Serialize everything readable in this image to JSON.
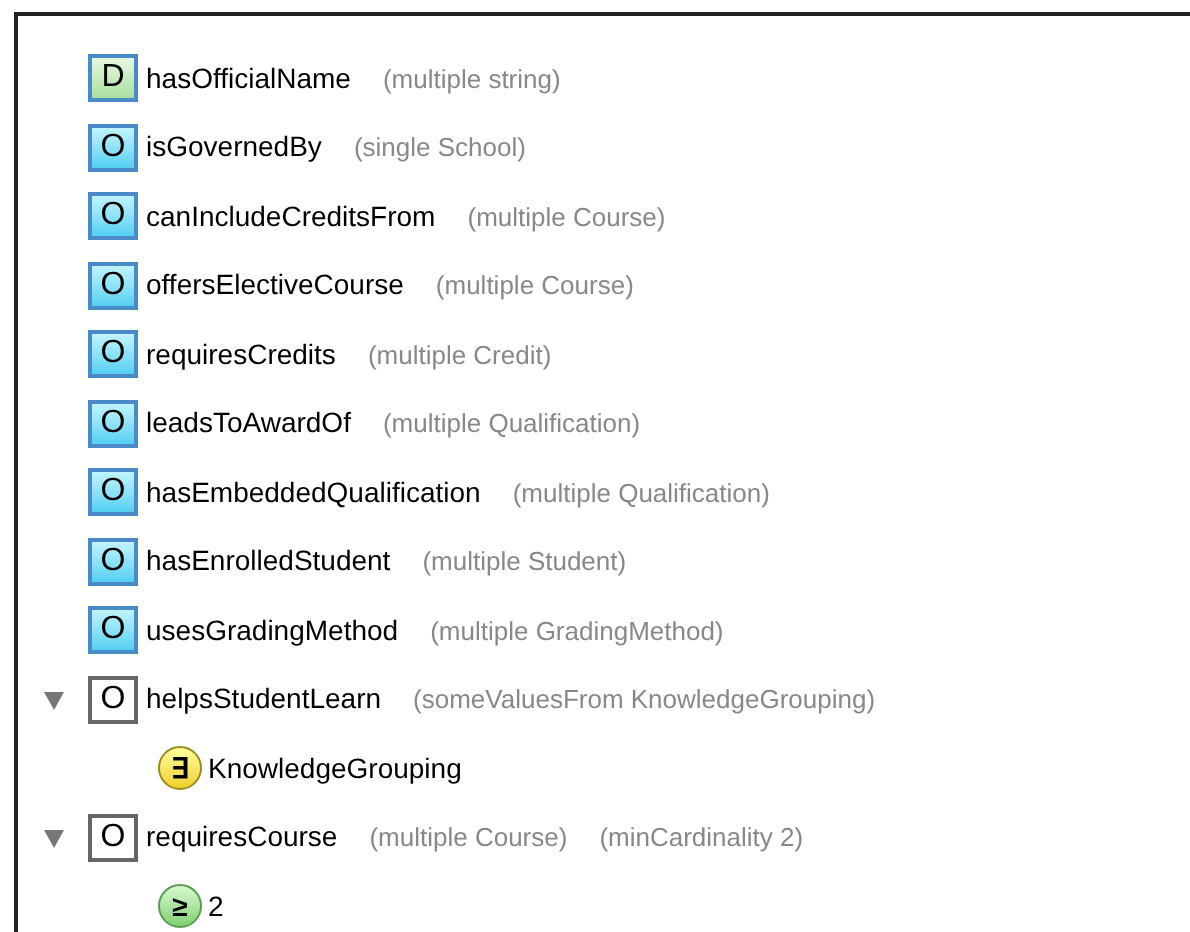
{
  "properties": [
    {
      "kind": "datatype",
      "icon": "D",
      "name": "hasOfficialName",
      "details": [
        "(multiple string)"
      ]
    },
    {
      "kind": "object",
      "icon": "O",
      "name": "isGovernedBy",
      "details": [
        "(single School)"
      ]
    },
    {
      "kind": "object",
      "icon": "O",
      "name": "canIncludeCreditsFrom",
      "details": [
        "(multiple Course)"
      ]
    },
    {
      "kind": "object",
      "icon": "O",
      "name": "offersElectiveCourse",
      "details": [
        "(multiple Course)"
      ]
    },
    {
      "kind": "object",
      "icon": "O",
      "name": "requiresCredits",
      "details": [
        "(multiple Credit)"
      ]
    },
    {
      "kind": "object",
      "icon": "O",
      "name": "leadsToAwardOf",
      "details": [
        "(multiple Qualification)"
      ]
    },
    {
      "kind": "object",
      "icon": "O",
      "name": "hasEmbeddedQualification",
      "details": [
        "(multiple Qualification)"
      ]
    },
    {
      "kind": "object",
      "icon": "O",
      "name": "hasEnrolledStudent",
      "details": [
        "(multiple Student)"
      ]
    },
    {
      "kind": "object",
      "icon": "O",
      "name": "usesGradingMethod",
      "details": [
        "(multiple GradingMethod)"
      ]
    },
    {
      "kind": "restricted",
      "icon": "O",
      "name": "helpsStudentLearn",
      "details": [
        "(someValuesFrom KnowledgeGrouping)"
      ],
      "expanded": true,
      "children": [
        {
          "kind": "some",
          "icon": "∃",
          "name": "KnowledgeGrouping"
        }
      ]
    },
    {
      "kind": "restricted",
      "icon": "O",
      "name": "requiresCourse",
      "details": [
        "(multiple Course)",
        "(minCardinality 2)"
      ],
      "expanded": true,
      "children": [
        {
          "kind": "min",
          "icon": "≥",
          "name": "2"
        }
      ]
    }
  ]
}
